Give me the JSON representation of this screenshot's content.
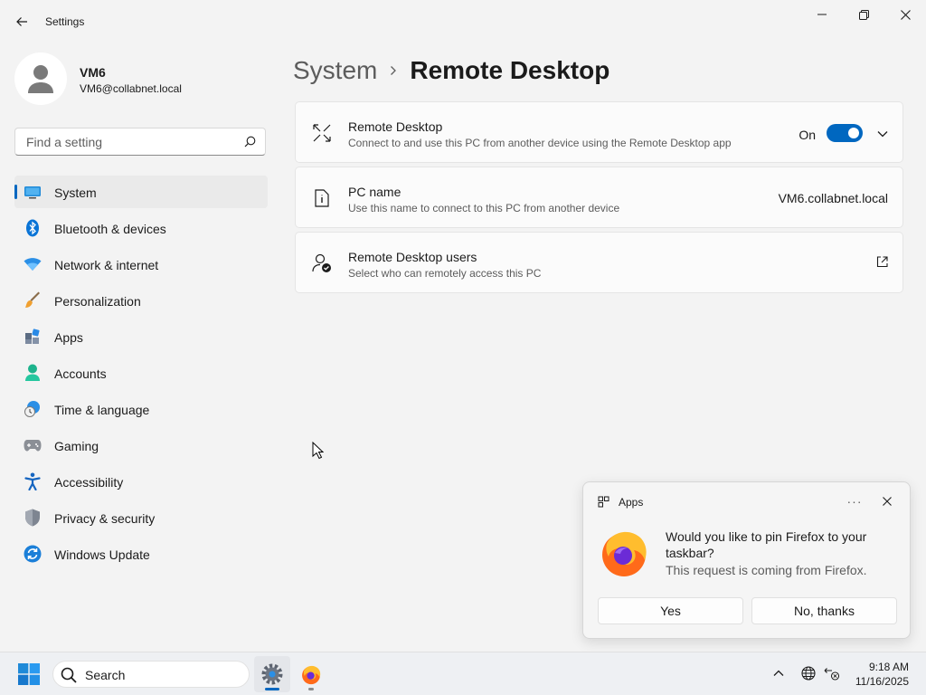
{
  "app": {
    "title": "Settings"
  },
  "user": {
    "name": "VM6",
    "email": "VM6@collabnet.local"
  },
  "search": {
    "placeholder": "Find a setting"
  },
  "nav": {
    "items": [
      {
        "label": "System",
        "icon": "system-icon",
        "active": true
      },
      {
        "label": "Bluetooth & devices",
        "icon": "bluetooth-icon"
      },
      {
        "label": "Network & internet",
        "icon": "wifi-icon"
      },
      {
        "label": "Personalization",
        "icon": "brush-icon"
      },
      {
        "label": "Apps",
        "icon": "apps-icon"
      },
      {
        "label": "Accounts",
        "icon": "accounts-icon"
      },
      {
        "label": "Time & language",
        "icon": "time-language-icon"
      },
      {
        "label": "Gaming",
        "icon": "gamepad-icon"
      },
      {
        "label": "Accessibility",
        "icon": "accessibility-icon"
      },
      {
        "label": "Privacy & security",
        "icon": "shield-icon"
      },
      {
        "label": "Windows Update",
        "icon": "update-icon"
      }
    ]
  },
  "breadcrumb": {
    "parent": "System",
    "current": "Remote Desktop"
  },
  "cards": {
    "remote_desktop": {
      "title": "Remote Desktop",
      "description": "Connect to and use this PC from another device using the Remote Desktop app",
      "toggle_label": "On",
      "toggle_on": true
    },
    "pc_name": {
      "title": "PC name",
      "description": "Use this name to connect to this PC from another device",
      "value": "VM6.collabnet.local"
    },
    "users": {
      "title": "Remote Desktop users",
      "description": "Select who can remotely access this PC"
    }
  },
  "notification": {
    "app": "Apps",
    "more": "···",
    "message": "Would you like to pin Firefox to your taskbar?",
    "sub": "This request is coming from Firefox.",
    "yes": "Yes",
    "no": "No, thanks"
  },
  "taskbar": {
    "search_label": "Search",
    "time": "9:18 AM",
    "date": "11/16/2025"
  },
  "colors": {
    "accent": "#0067c0"
  }
}
